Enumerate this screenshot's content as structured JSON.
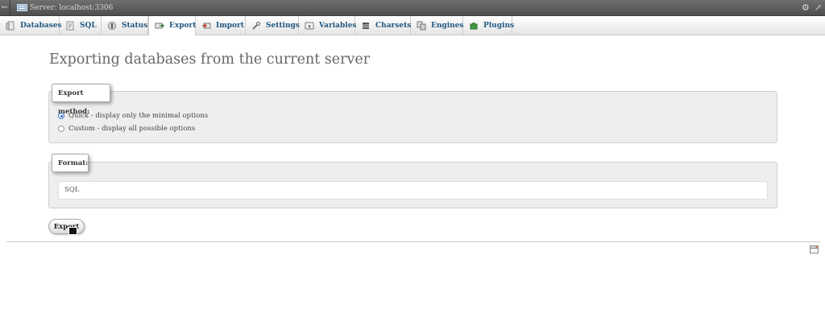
{
  "window": {
    "title": "Server: localhost:3306"
  },
  "tabs": [
    {
      "label": "Databases",
      "icon": "database-icon"
    },
    {
      "label": "SQL",
      "icon": "sql-icon"
    },
    {
      "label": "Status",
      "icon": "status-icon"
    },
    {
      "label": "Export",
      "icon": "export-icon",
      "active": true
    },
    {
      "label": "Import",
      "icon": "import-icon"
    },
    {
      "label": "Settings",
      "icon": "wrench-icon"
    },
    {
      "label": "Variables",
      "icon": "variables-icon"
    },
    {
      "label": "Charsets",
      "icon": "charsets-icon"
    },
    {
      "label": "Engines",
      "icon": "engines-icon"
    },
    {
      "label": "Plugins",
      "icon": "puzzle-icon"
    }
  ],
  "main": {
    "title": "Exporting databases from the current server",
    "export_method": {
      "legend": "Export method:",
      "options": [
        {
          "label": "Quick - display only the minimal options",
          "checked": true
        },
        {
          "label": "Custom - display all possible options",
          "checked": false
        }
      ]
    },
    "format": {
      "legend": "Format:",
      "selected": "SQL"
    },
    "export_button": "Export"
  },
  "colors": {
    "tab_text": "#235a81",
    "title_text": "#666666",
    "panel_bg": "#eeeeee"
  }
}
